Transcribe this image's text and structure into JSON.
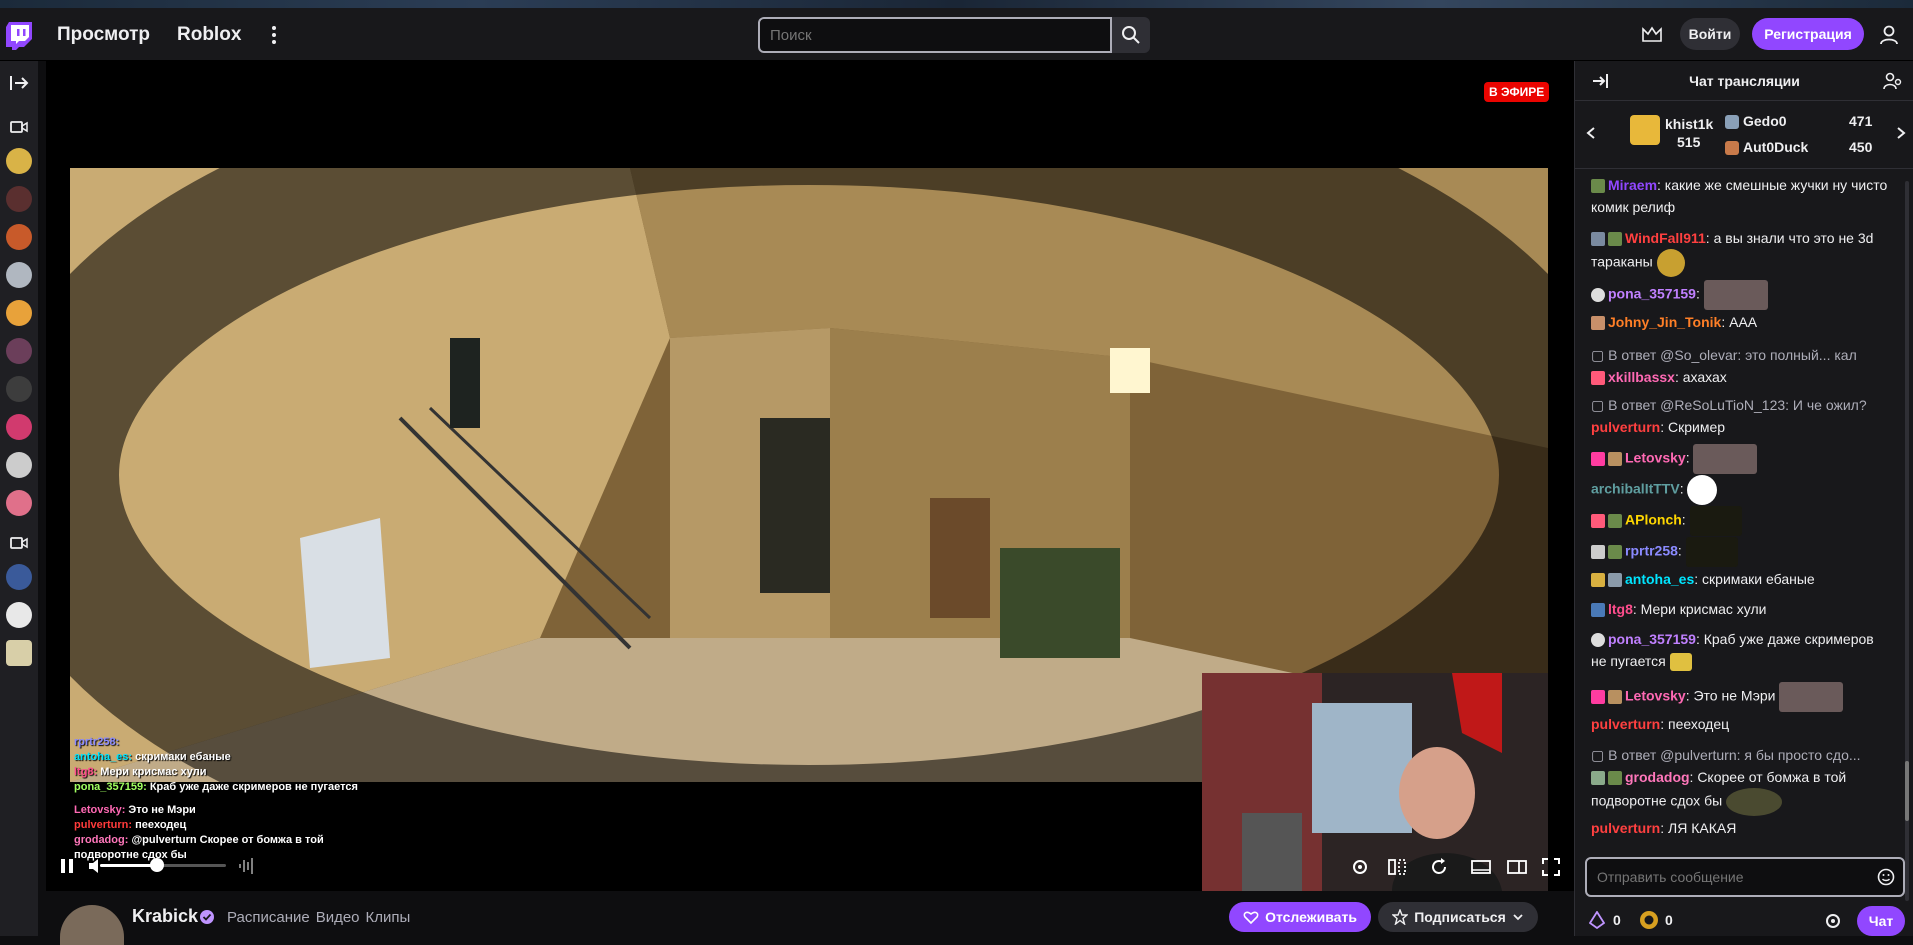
{
  "nav": {
    "browse": "Просмотр",
    "game": "Roblox",
    "search_placeholder": "Поиск",
    "login": "Войти",
    "register": "Регистрация"
  },
  "player": {
    "live_badge": "В ЭФИРЕ",
    "volume_level": 0.45
  },
  "overlay_chat": [
    {
      "user": "rprtr258:",
      "text": "",
      "color": "#8a8aff"
    },
    {
      "user": "antoha_es:",
      "text": "скримаки ебаные",
      "color": "#00e5ff"
    },
    {
      "user": "ltg8:",
      "text": "Мери крисмас хули",
      "color": "#ff4d8d"
    },
    {
      "user": "pona_357159:",
      "text": "Краб уже даже скримеров не пугается",
      "color": "#a0ff60"
    },
    {
      "user": "Letovsky:",
      "text": "Это не Мэри",
      "color": "#ff69b4"
    },
    {
      "user": "pulverturn:",
      "text": "пеeходец",
      "color": "#ff3b3b"
    },
    {
      "user": "grodadog:",
      "text": "@pulverturn Скорее от бомжа в той",
      "color": "#ff77bb"
    },
    {
      "user": "",
      "text": "подворотне сдох бы",
      "color": "#ffffff"
    }
  ],
  "channel": {
    "name": "Krabick",
    "links": [
      "Расписание",
      "Видео",
      "Клипы"
    ],
    "follow": "Отслеживать",
    "subscribe": "Подписаться"
  },
  "chat": {
    "title": "Чат трансляции",
    "gifters": [
      {
        "name": "khist1k",
        "count": "515"
      },
      {
        "name": "Gedo0",
        "count": "471"
      },
      {
        "name": "Aut0Duck",
        "count": "450"
      }
    ],
    "messages": [
      {
        "user": "Miraem",
        "color": "#9147ff",
        "text": ": какие же смешные жучки ну чисто комик релиф"
      },
      {
        "user": "WindFall911",
        "color": "#ff4040",
        "text": ": а вы знали что это не 3d тараканы"
      },
      {
        "user": "pona_357159",
        "color": "#c080ff",
        "text": ":"
      },
      {
        "user": "Johny_Jin_Tonik",
        "color": "#ff7f27",
        "text": ": ААА"
      },
      {
        "reply": "В ответ @So_olevar: это полный... кал",
        "user": "xkillbassx",
        "color": "#ff69b4",
        "text": ": ахахах"
      },
      {
        "reply": "В ответ @ReSoLuTioN_123: И че ожил?",
        "user": "pulverturn",
        "color": "#ff4040",
        "text": ": Скример"
      },
      {
        "user": "Letovsky",
        "color": "#ff69b4",
        "text": ":"
      },
      {
        "user": "archibalItTTV",
        "color": "#5f9ea0",
        "text": ":"
      },
      {
        "user": "APlonch",
        "color": "#ffd700",
        "text": ":"
      },
      {
        "user": "rprtr258",
        "color": "#8a8aff",
        "text": ":"
      },
      {
        "user": "antoha_es",
        "color": "#00e5ff",
        "text": ": скримаки ебаные"
      },
      {
        "user": "ltg8",
        "color": "#ff4d8d",
        "text": ": Мери крисмас хули"
      },
      {
        "user": "pona_357159",
        "color": "#c080ff",
        "text": ": Краб уже даже скримеров не пугается"
      },
      {
        "user": "Letovsky",
        "color": "#ff69b4",
        "text": ": Это не Мэри"
      },
      {
        "user": "pulverturn",
        "color": "#ff4040",
        "text": ": пееходец"
      },
      {
        "reply": "В ответ @pulverturn: я бы просто сдо...",
        "user": "grodadog",
        "color": "#ff77bb",
        "text": ": Скорее от бомжа в той подворотне сдох бы"
      },
      {
        "user": "pulverturn",
        "color": "#ff4040",
        "text": ": ЛЯ КАКАЯ"
      }
    ],
    "input_placeholder": "Отправить сообщение",
    "points_a": "0",
    "points_b": "0",
    "chat_button": "Чат"
  }
}
